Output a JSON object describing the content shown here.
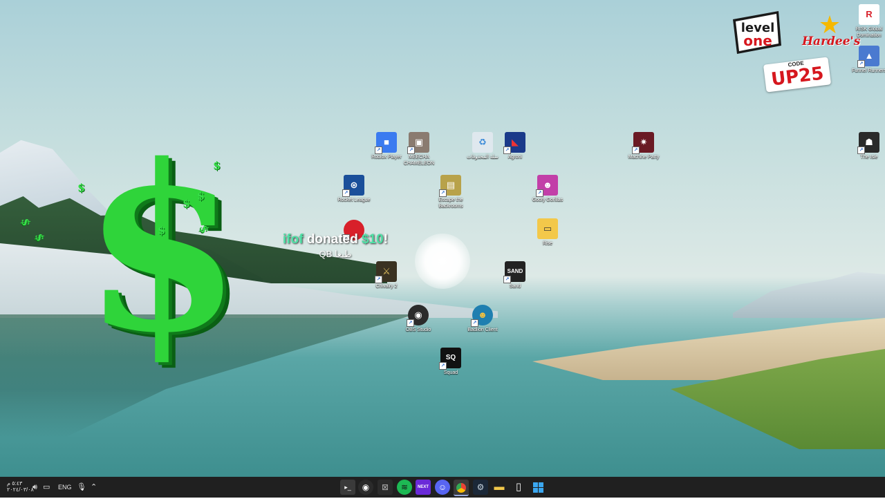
{
  "desktop_icons": {
    "roblox": "Roblox Player",
    "meecha": "MEECHA CHAMELEON",
    "recycle": "سلة المحذوفات",
    "agroni": "Agroni",
    "machine_party": "Machine Party",
    "the_isle": "The Isle",
    "rocket_league": "Rocket League",
    "escape_backrooms": "Escape the Backrooms",
    "gorilla": "Goofy Gorillas",
    "folder": "Rise",
    "chivalry": "Chivalry 2",
    "sand": "Sand",
    "obs": "OBS Studio",
    "badlion": "Badlion Client",
    "squad": "Squad",
    "risk": "RISK Global Domination",
    "funnel": "Funnel Runners"
  },
  "icon_colors": {
    "roblox": "#3b7bf0",
    "meecha": "#8a7b70",
    "recycle": "#dfe8ee",
    "agroni": "#1a3a8a",
    "machine_party": "#6a1a24",
    "the_isle": "#2a2a2a",
    "rocket_league": "#1a4f9a",
    "escape_backrooms": "#b8a24a",
    "gorilla": "#c23fa8",
    "folder": "#f3c84a",
    "chivalry": "#3a3222",
    "sand": "#222222",
    "obs": "#2b2b2b",
    "badlion": "#1f7fb0",
    "squad": "#111111",
    "risk": "#d8202a",
    "funnel": "#4a7ad0"
  },
  "icon_glyphs": {
    "roblox": "■",
    "meecha": "▣",
    "recycle": "♻",
    "agroni": "◣",
    "machine_party": "✷",
    "the_isle": "☗",
    "rocket_league": "⊛",
    "escape_backrooms": "▤",
    "gorilla": "☻",
    "folder": "▭",
    "chivalry": "⚔",
    "sand": "SAND",
    "obs": "◉",
    "badlion": "☻",
    "squad": "SQ",
    "risk": "R",
    "funnel": "▲"
  },
  "overlay": {
    "alert_user": "ifof",
    "alert_verb": "donated",
    "alert_amount": "$10",
    "alert_bang": "!",
    "alert_message": "QB طبعا",
    "dollar_symbol": "$",
    "level_one_line1": "level",
    "level_one_line2": "one",
    "hardees_name": "Hardee's",
    "promo_label": "CODE",
    "promo_code": "UP25"
  },
  "taskbar": {
    "clock_time": "٥:٤٣ م",
    "clock_date": "٢٠٢٤/٠٣/٠٨",
    "language": "ENG",
    "apps": [
      "terminal-icon",
      "obs-icon",
      "capture-icon",
      "spotify-icon",
      "next-icon",
      "discord-icon",
      "chrome-icon",
      "steam-icon",
      "explorer-icon",
      "notepad-icon",
      "start-icon"
    ],
    "next_label": "NEXT"
  },
  "colors": {
    "taskbar_bg": "#202020",
    "dollar_green": "#2fd43a",
    "alert_highlight": "#4fe0a6",
    "hardees_red": "#d6171e"
  }
}
